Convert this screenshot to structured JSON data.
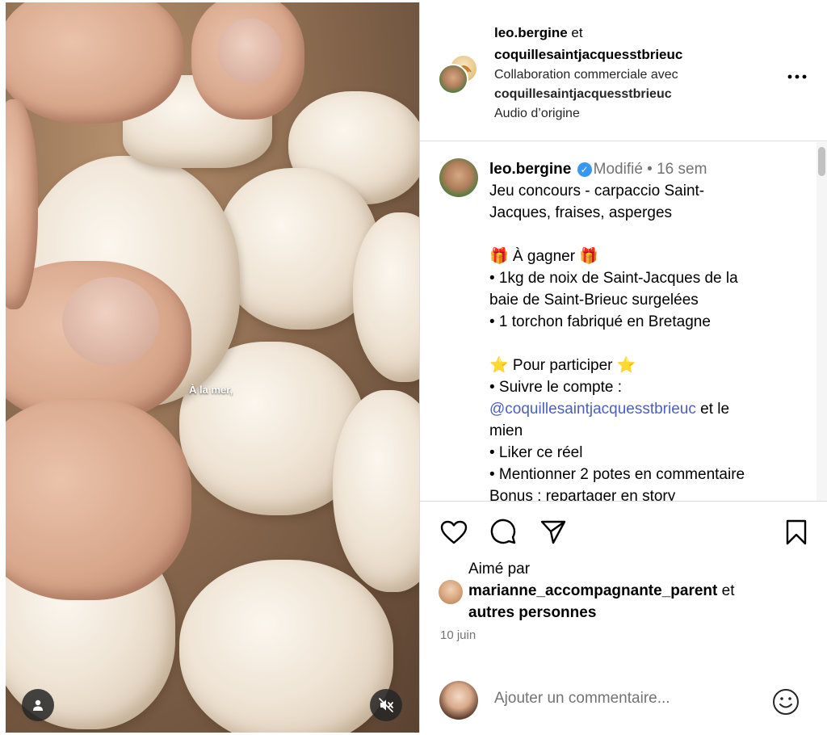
{
  "media": {
    "subtitle": "À la mer,"
  },
  "header": {
    "user1": "leo.bergine",
    "connector": " et",
    "user2": "coquillesaintjacquesstbrieuc",
    "collab_prefix": "Collaboration commerciale avec",
    "collab_account": "coquillesaintjacquesstbrieuc",
    "audio": "Audio d’origine",
    "more_icon": "more-horizontal-icon"
  },
  "caption": {
    "username": "leo.bergine",
    "verified_icon": "verified-badge-icon",
    "edited": "Modifié",
    "separator": " • ",
    "time": "16 sem",
    "lines": [
      "Jeu concours - carpaccio Saint-",
      "Jacques, fraises, asperges"
    ],
    "win_title": "🎁 À gagner 🎁",
    "win_items": [
      "• 1kg de noix de Saint-Jacques de la",
      "baie de Saint-Brieuc surgelées",
      "• 1 torchon fabriqué en Bretagne"
    ],
    "participate_title": "⭐ Pour participer ⭐",
    "follow_line": "• Suivre le compte :",
    "mention": "@coquillesaintjacquesstbrieuc",
    "mention_suffix": " et le",
    "mention_suffix2": "mien",
    "like_line": "• Liker ce réel",
    "tag_line": "• Mentionner 2 potes en commentaire",
    "bonus_line": "Bonus : repartager en story"
  },
  "actions": {
    "like_icon": "heart-icon",
    "comment_icon": "comment-icon",
    "share_icon": "share-icon",
    "save_icon": "bookmark-icon"
  },
  "likes": {
    "prefix": "Aimé par",
    "user": "marianne_accompagnante_parent",
    "connector": " et",
    "others": "autres personnes"
  },
  "date": "10 juin",
  "comment": {
    "placeholder": "Ajouter un commentaire...",
    "emoji_icon": "emoji-icon"
  },
  "colors": {
    "link": "#4a5fc1",
    "verified": "#3897f0",
    "muted": "#737373",
    "border": "#dbdbdb"
  }
}
